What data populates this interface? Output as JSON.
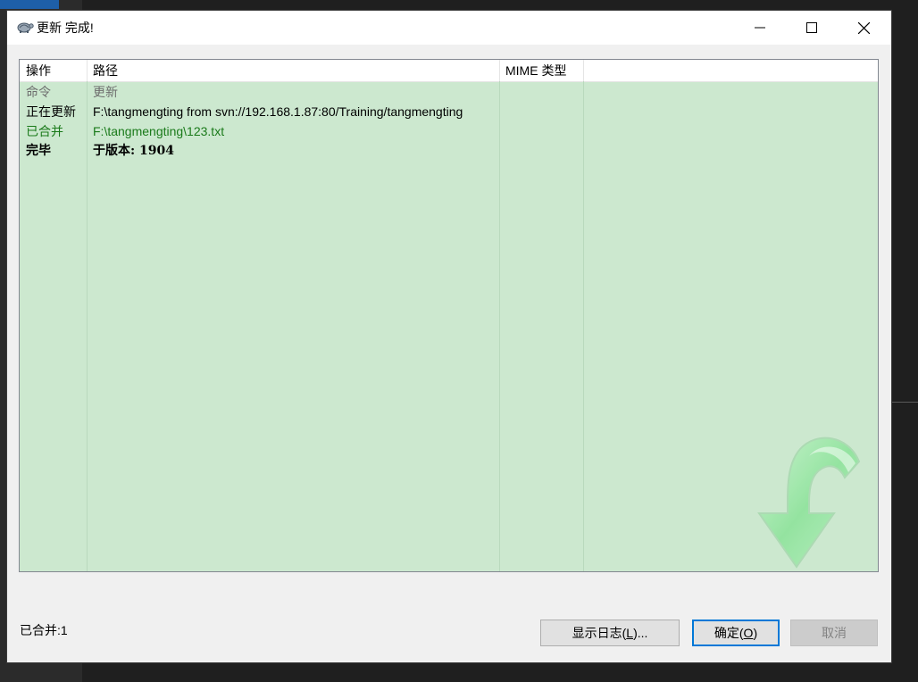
{
  "window": {
    "title": "更新 完成!"
  },
  "columns": [
    "操作",
    "路径",
    "MIME 类型"
  ],
  "rows": [
    {
      "action": "命令",
      "path": "更新",
      "style": "gray"
    },
    {
      "action": "正在更新",
      "path": "F:\\tangmengting from svn://192.168.1.87:80/Training/tangmengting",
      "style": "black"
    },
    {
      "action": "已合并",
      "path": "F:\\tangmengting\\123.txt",
      "style": "green"
    },
    {
      "action": "完毕",
      "path": "于版本: 1904",
      "style": "bold"
    }
  ],
  "status": {
    "text": "已合并:1"
  },
  "buttons": {
    "show_log": {
      "pre": "显示日志(",
      "key": "L",
      "post": ")..."
    },
    "ok": {
      "pre": "确定(",
      "key": "O",
      "post": ")"
    },
    "cancel": "取消"
  },
  "icons": {
    "app": "tortoise-icon",
    "minimize": "minimize-icon",
    "maximize": "maximize-icon",
    "close": "close-icon",
    "watermark": "update-arrow-icon"
  },
  "colors": {
    "list_background": "#cce8cf",
    "merged_text": "#1a7a1a",
    "command_text": "#6d6d6d",
    "ok_focus": "#0078d7"
  }
}
